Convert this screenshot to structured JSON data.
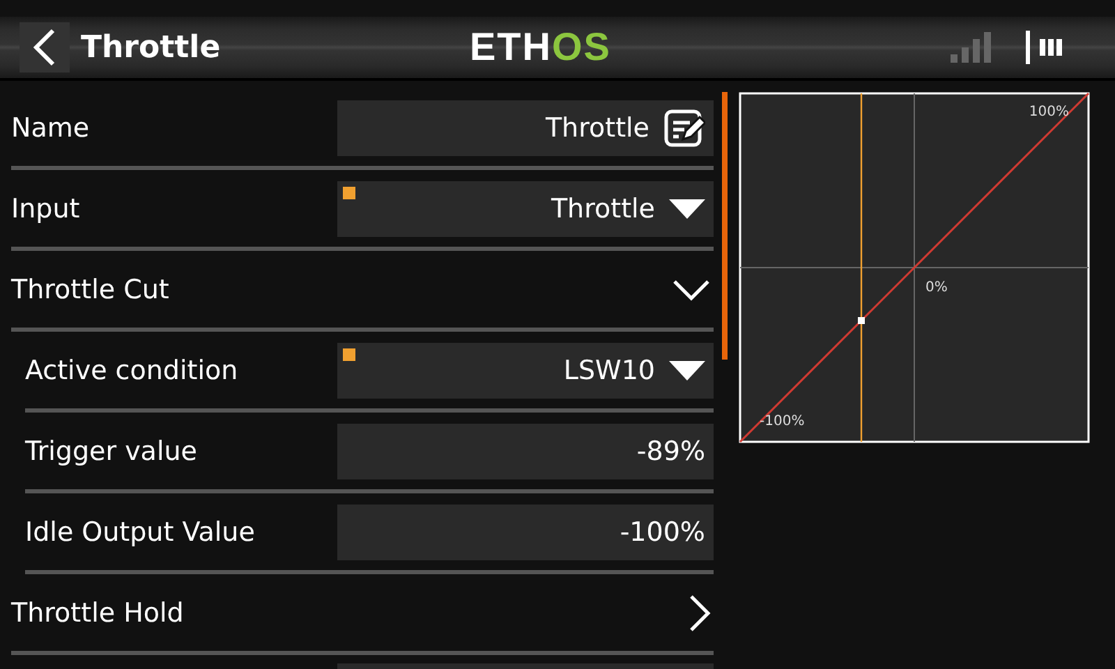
{
  "header": {
    "title": "Throttle",
    "logo": [
      {
        "text": "ETH",
        "color": "#ffffff"
      },
      {
        "text": "OS",
        "color": "#8cc63f"
      }
    ]
  },
  "rows": [
    {
      "kind": "edit",
      "label": "Name",
      "value": "Throttle"
    },
    {
      "kind": "choice",
      "label": "Input",
      "value": "Throttle"
    },
    {
      "kind": "section",
      "label": "Throttle Cut",
      "expanded": true,
      "children": [
        {
          "kind": "choice",
          "label": "Active condition",
          "value": "LSW10"
        },
        {
          "kind": "number",
          "label": "Trigger value",
          "value": "-89%"
        },
        {
          "kind": "number",
          "label": "Idle Output Value",
          "value": "-100%"
        }
      ]
    },
    {
      "kind": "section",
      "label": "Throttle Hold",
      "expanded": false
    }
  ],
  "graph": {
    "labels": [
      "100%",
      "0%",
      "-100%"
    ]
  }
}
